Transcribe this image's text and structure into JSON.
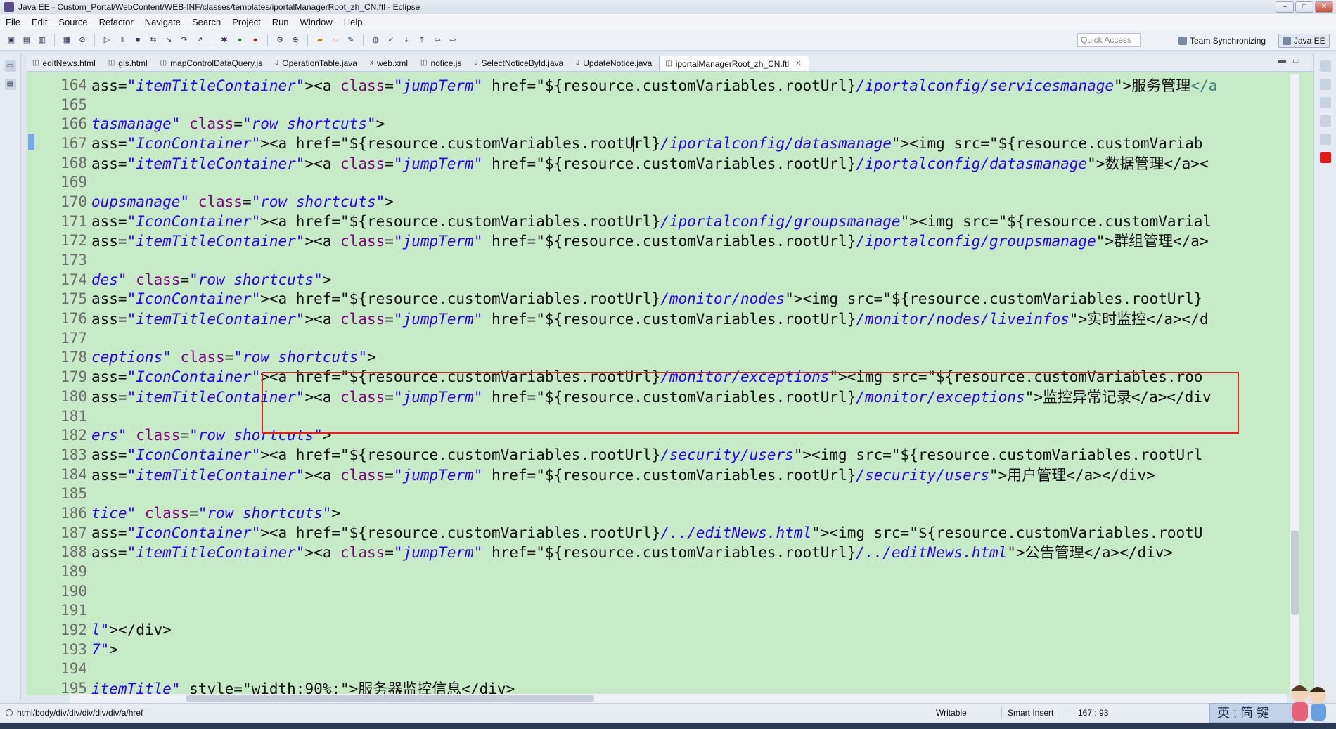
{
  "window": {
    "title": "Java EE - Custom_Portal/WebContent/WEB-INF/classes/templates/iportalManagerRoot_zh_CN.ftl - Eclipse",
    "minimize": "‒",
    "maximize": "□",
    "close": "✕"
  },
  "menu": [
    "File",
    "Edit",
    "Source",
    "Refactor",
    "Navigate",
    "Search",
    "Project",
    "Run",
    "Window",
    "Help"
  ],
  "toolbar": {
    "quick_access_placeholder": "Quick Access",
    "perspectives": [
      "Team Synchronizing",
      "Java EE"
    ]
  },
  "tabs": [
    {
      "label": "editNews.html",
      "icon": "html-file-icon",
      "active": false
    },
    {
      "label": "gis.html",
      "icon": "html-file-icon",
      "active": false
    },
    {
      "label": "mapControlDataQuery.js",
      "icon": "js-file-icon",
      "active": false
    },
    {
      "label": "OperationTable.java",
      "icon": "java-file-icon",
      "active": false
    },
    {
      "label": "web.xml",
      "icon": "xml-file-icon",
      "active": false
    },
    {
      "label": "notice.js",
      "icon": "js-file-icon",
      "active": false
    },
    {
      "label": "SelectNoticeById.java",
      "icon": "java-file-icon",
      "active": false
    },
    {
      "label": "UpdateNotice.java",
      "icon": "java-file-icon",
      "active": false
    },
    {
      "label": "iportalManagerRoot_zh_CN.ftl",
      "icon": "ftl-file-icon",
      "active": true
    }
  ],
  "editor": {
    "cursor_line": 167,
    "lines": [
      {
        "n": "164",
        "segs": [
          [
            "k",
            "ass="
          ],
          [
            "s",
            "\"itemTitleContainer\""
          ],
          [
            "k",
            "><a "
          ],
          [
            "a",
            "class"
          ],
          [
            "k",
            "="
          ],
          [
            "s",
            "\"jumpTerm\""
          ],
          [
            "k",
            " href=\"${resource.customVariables.rootUrl}"
          ],
          [
            "italic-blue",
            "/iportalconfig/servicesmanage"
          ],
          [
            "k",
            "\">服务管理"
          ],
          [
            "t",
            "</a"
          ]
        ]
      },
      {
        "n": "165",
        "segs": []
      },
      {
        "n": "166",
        "segs": [
          [
            "italic-blue",
            "tasmanage\""
          ],
          [
            "k",
            " "
          ],
          [
            "a",
            "class"
          ],
          [
            "k",
            "="
          ],
          [
            "s",
            "\"row shortcuts\""
          ],
          [
            "k",
            ">"
          ]
        ]
      },
      {
        "n": "167",
        "segs": [
          [
            "k",
            "ass="
          ],
          [
            "s",
            "\"IconContainer\""
          ],
          [
            "k",
            "><a href=\"${resource.customVariables.rootU"
          ],
          [
            "caret",
            ""
          ],
          [
            "k",
            "rl}"
          ],
          [
            "italic-blue",
            "/iportalconfig/datasmanage"
          ],
          [
            "k",
            "\"><img src=\"${resource.customVariab"
          ]
        ]
      },
      {
        "n": "168",
        "segs": [
          [
            "k",
            "ass="
          ],
          [
            "s",
            "\"itemTitleContainer\""
          ],
          [
            "k",
            "><a "
          ],
          [
            "a",
            "class"
          ],
          [
            "k",
            "="
          ],
          [
            "s",
            "\"jumpTerm\""
          ],
          [
            "k",
            " href=\"${resource.customVariables.rootUrl}"
          ],
          [
            "italic-blue",
            "/iportalconfig/datasmanage"
          ],
          [
            "k",
            "\">数据管理</a><"
          ]
        ]
      },
      {
        "n": "169",
        "segs": []
      },
      {
        "n": "170",
        "segs": [
          [
            "italic-blue",
            "oupsmanage\""
          ],
          [
            "k",
            " "
          ],
          [
            "a",
            "class"
          ],
          [
            "k",
            "="
          ],
          [
            "s",
            "\"row shortcuts\""
          ],
          [
            "k",
            ">"
          ]
        ]
      },
      {
        "n": "171",
        "segs": [
          [
            "k",
            "ass="
          ],
          [
            "s",
            "\"IconContainer\""
          ],
          [
            "k",
            "><a href=\"${resource.customVariables.rootUrl}"
          ],
          [
            "italic-blue",
            "/iportalconfig/groupsmanage"
          ],
          [
            "k",
            "\"><img src=\"${resource.customVarial"
          ]
        ]
      },
      {
        "n": "172",
        "segs": [
          [
            "k",
            "ass="
          ],
          [
            "s",
            "\"itemTitleContainer\""
          ],
          [
            "k",
            "><a "
          ],
          [
            "a",
            "class"
          ],
          [
            "k",
            "="
          ],
          [
            "s",
            "\"jumpTerm\""
          ],
          [
            "k",
            " href=\"${resource.customVariables.rootUrl}"
          ],
          [
            "italic-blue",
            "/iportalconfig/groupsmanage"
          ],
          [
            "k",
            "\">群组管理</a>"
          ]
        ]
      },
      {
        "n": "173",
        "segs": []
      },
      {
        "n": "174",
        "segs": [
          [
            "italic-blue",
            "des\""
          ],
          [
            "k",
            " "
          ],
          [
            "a",
            "class"
          ],
          [
            "k",
            "="
          ],
          [
            "s",
            "\"row shortcuts\""
          ],
          [
            "k",
            ">"
          ]
        ]
      },
      {
        "n": "175",
        "segs": [
          [
            "k",
            "ass="
          ],
          [
            "s",
            "\"IconContainer\""
          ],
          [
            "k",
            "><a href=\"${resource.customVariables.rootUrl}"
          ],
          [
            "italic-blue",
            "/monitor/nodes"
          ],
          [
            "k",
            "\"><img src=\"${resource.customVariables.rootUrl}"
          ]
        ]
      },
      {
        "n": "176",
        "segs": [
          [
            "k",
            "ass="
          ],
          [
            "s",
            "\"itemTitleContainer\""
          ],
          [
            "k",
            "><a "
          ],
          [
            "a",
            "class"
          ],
          [
            "k",
            "="
          ],
          [
            "s",
            "\"jumpTerm\""
          ],
          [
            "k",
            " href=\"${resource.customVariables.rootUrl}"
          ],
          [
            "italic-blue",
            "/monitor/nodes/liveinfos"
          ],
          [
            "k",
            "\">实时监控</a></d"
          ]
        ]
      },
      {
        "n": "177",
        "segs": []
      },
      {
        "n": "178",
        "segs": [
          [
            "italic-blue",
            "ceptions\""
          ],
          [
            "k",
            " "
          ],
          [
            "a",
            "class"
          ],
          [
            "k",
            "="
          ],
          [
            "s",
            "\"row shortcuts\""
          ],
          [
            "k",
            ">"
          ]
        ]
      },
      {
        "n": "179",
        "segs": [
          [
            "k",
            "ass="
          ],
          [
            "s",
            "\"IconContainer\""
          ],
          [
            "k",
            "><a href=\"${resource.customVariables.rootUrl}"
          ],
          [
            "italic-blue",
            "/monitor/exceptions"
          ],
          [
            "k",
            "\"><img src=\"${resource.customVariables.roo"
          ]
        ]
      },
      {
        "n": "180",
        "segs": [
          [
            "k",
            "ass="
          ],
          [
            "s",
            "\"itemTitleContainer\""
          ],
          [
            "k",
            "><a "
          ],
          [
            "a",
            "class"
          ],
          [
            "k",
            "="
          ],
          [
            "s",
            "\"jumpTerm\""
          ],
          [
            "k",
            " href=\"${resource.customVariables.rootUrl}"
          ],
          [
            "italic-blue",
            "/monitor/exceptions"
          ],
          [
            "k",
            "\">监控异常记录</a></div"
          ]
        ]
      },
      {
        "n": "181",
        "segs": []
      },
      {
        "n": "182",
        "segs": [
          [
            "italic-blue",
            "ers\""
          ],
          [
            "k",
            " "
          ],
          [
            "a",
            "class"
          ],
          [
            "k",
            "="
          ],
          [
            "s",
            "\"row shortcuts\""
          ],
          [
            "k",
            ">"
          ]
        ]
      },
      {
        "n": "183",
        "segs": [
          [
            "k",
            "ass="
          ],
          [
            "s",
            "\"IconContainer\""
          ],
          [
            "k",
            "><a href=\"${resource.customVariables.rootUrl}"
          ],
          [
            "italic-blue",
            "/security/users"
          ],
          [
            "k",
            "\"><img src=\"${resource.customVariables.rootUrl"
          ]
        ]
      },
      {
        "n": "184",
        "segs": [
          [
            "k",
            "ass="
          ],
          [
            "s",
            "\"itemTitleContainer\""
          ],
          [
            "k",
            "><a "
          ],
          [
            "a",
            "class"
          ],
          [
            "k",
            "="
          ],
          [
            "s",
            "\"jumpTerm\""
          ],
          [
            "k",
            " href=\"${resource.customVariables.rootUrl}"
          ],
          [
            "italic-blue",
            "/security/users"
          ],
          [
            "k",
            "\">用户管理</a></div>"
          ]
        ]
      },
      {
        "n": "185",
        "segs": []
      },
      {
        "n": "186",
        "segs": [
          [
            "italic-blue",
            "tice\""
          ],
          [
            "k",
            " "
          ],
          [
            "a",
            "class"
          ],
          [
            "k",
            "="
          ],
          [
            "s",
            "\"row shortcuts\""
          ],
          [
            "k",
            ">"
          ]
        ]
      },
      {
        "n": "187",
        "segs": [
          [
            "k",
            "ass="
          ],
          [
            "s",
            "\"IconContainer\""
          ],
          [
            "k",
            "><a href=\"${resource.customVariables.rootUrl}"
          ],
          [
            "italic-blue",
            "/../editNews.html"
          ],
          [
            "k",
            "\"><img src=\"${resource.customVariables.rootU"
          ]
        ]
      },
      {
        "n": "188",
        "segs": [
          [
            "k",
            "ass="
          ],
          [
            "s",
            "\"itemTitleContainer\""
          ],
          [
            "k",
            "><a "
          ],
          [
            "a",
            "class"
          ],
          [
            "k",
            "="
          ],
          [
            "s",
            "\"jumpTerm\""
          ],
          [
            "k",
            " href=\"${resource.customVariables.rootUrl}"
          ],
          [
            "italic-blue",
            "/../editNews.html"
          ],
          [
            "k",
            "\">公告管理</a></div>"
          ]
        ]
      },
      {
        "n": "189",
        "segs": []
      },
      {
        "n": "190",
        "segs": []
      },
      {
        "n": "191",
        "segs": []
      },
      {
        "n": "192",
        "segs": [
          [
            "italic-blue",
            "l\""
          ],
          [
            "k",
            "></div>"
          ]
        ]
      },
      {
        "n": "193",
        "segs": [
          [
            "italic-blue",
            "7\""
          ],
          [
            "k",
            ">"
          ]
        ]
      },
      {
        "n": "194",
        "segs": []
      },
      {
        "n": "195",
        "segs": [
          [
            "italic-blue",
            "itemTitle\""
          ],
          [
            "k",
            " style=\"width:90%;\">服务器监控信息</div>"
          ]
        ]
      }
    ]
  },
  "status": {
    "path": "html/body/div/div/div/div/div/a/href",
    "writable": "Writable",
    "insert_mode": "Smart Insert",
    "position": "167 : 93",
    "ime": "英 ; 简 键"
  }
}
